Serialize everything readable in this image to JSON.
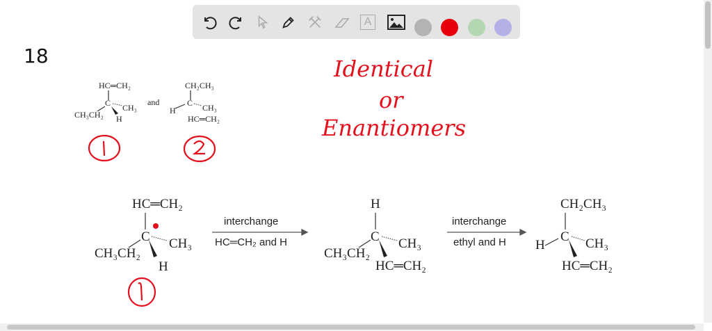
{
  "toolbar": {
    "tools": [
      "undo-icon",
      "redo-icon",
      "pointer-icon",
      "pen-icon",
      "tools-icon",
      "eraser-icon",
      "text-icon",
      "image-icon"
    ],
    "text_tool_glyph": "A",
    "colors": [
      "#b3b3b3",
      "#e8000b",
      "#b5d6b2",
      "#b3b0e6"
    ]
  },
  "canvas": {
    "problem_number": "18",
    "question": {
      "line1": "Identical",
      "line2": "or",
      "line3": "Enantiomers"
    },
    "top": {
      "mol1": {
        "top": "HC═CH₂",
        "center": "C",
        "right": "CH₃",
        "left": "CH₃CH₂",
        "bottom": "H"
      },
      "and_label": "and",
      "mol2": {
        "top": "CH₂CH₃",
        "left": "H",
        "center": "C",
        "right": "CH₃",
        "bottom": "HC═CH₂"
      },
      "label1": "1",
      "label2": "2"
    },
    "bottom": {
      "molA": {
        "top": "HC═CH₂",
        "center": "C",
        "right": "CH₃",
        "left": "CH₃CH₂",
        "bottom": "H",
        "label": "1"
      },
      "arrow1": {
        "above": "interchange",
        "below": "HC═CH₂ and H"
      },
      "molB": {
        "top": "H",
        "center": "C",
        "right": "CH₃",
        "left": "CH₃CH₂",
        "bottom": "HC═CH₂"
      },
      "arrow2": {
        "above": "interchange",
        "below": "ethyl and H"
      },
      "molC": {
        "top": "CH₂CH₃",
        "left": "H",
        "center": "C",
        "right": "CH₃",
        "bottom": "HC═CH₂"
      }
    }
  }
}
